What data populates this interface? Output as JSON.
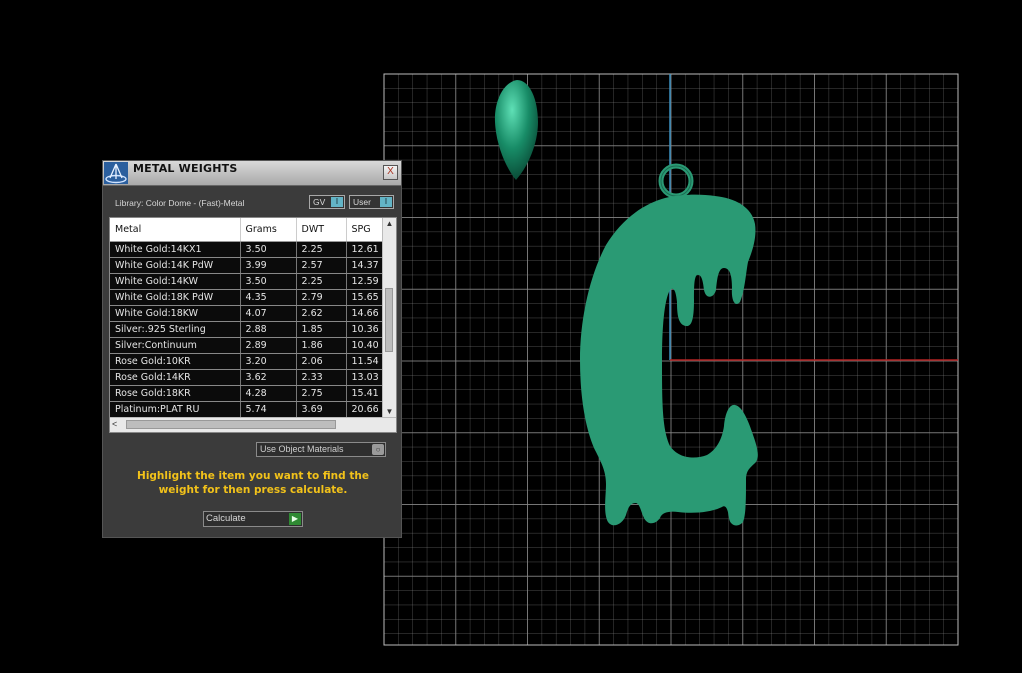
{
  "panel": {
    "title": "METAL WEIGHTS",
    "close_label": "X",
    "library_label": "Library: Color Dome - (Fast)-Metal",
    "toggles": [
      {
        "label": "GV",
        "indicator": "I"
      },
      {
        "label": "User",
        "indicator": "I"
      }
    ],
    "columns": [
      "Metal",
      "Grams",
      "DWT",
      "SPG"
    ],
    "rows": [
      [
        "White Gold:14KX1",
        "3.50",
        "2.25",
        "12.61"
      ],
      [
        "White Gold:14K PdW",
        "3.99",
        "2.57",
        "14.37"
      ],
      [
        "White Gold:14KW",
        "3.50",
        "2.25",
        "12.59"
      ],
      [
        "White Gold:18K PdW",
        "4.35",
        "2.79",
        "15.65"
      ],
      [
        "White Gold:18KW",
        "4.07",
        "2.62",
        "14.66"
      ],
      [
        "Silver:.925 Sterling",
        "2.88",
        "1.85",
        "10.36"
      ],
      [
        "Silver:Continuum",
        "2.89",
        "1.86",
        "10.40"
      ],
      [
        "Rose Gold:10KR",
        "3.20",
        "2.06",
        "11.54"
      ],
      [
        "Rose Gold:14KR",
        "3.62",
        "2.33",
        "13.03"
      ],
      [
        "Rose Gold:18KR",
        "4.28",
        "2.75",
        "15.41"
      ],
      [
        "Platinum:PLAT RU",
        "5.74",
        "3.69",
        "20.66"
      ]
    ],
    "use_object_materials_label": "Use Object Materials",
    "instruction_text": "Highlight the item you want to find the weight for then press calculate.",
    "calculate_label": "Calculate"
  },
  "viewport": {
    "model_color": "#2a9a74",
    "grid_color": "#8a8a8a",
    "axis_x_color": "#b22222",
    "axis_y_color": "#3a8fbf"
  }
}
